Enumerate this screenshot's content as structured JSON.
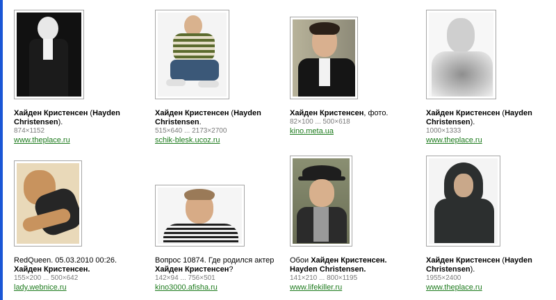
{
  "results": [
    {
      "title_pre": "",
      "title_bold": "Хайден Кристенсен",
      "title_post": " (",
      "title_bold2": "Hayden Christensen",
      "title_end": ").",
      "size": "874×1152",
      "url": "www.theplace.ru"
    },
    {
      "title_pre": "",
      "title_bold": "Хайден Кристенсен",
      "title_post": " (",
      "title_bold2": "Hayden Christensen",
      "title_end": ".",
      "size": "515×640 ... 2173×2700",
      "url": "schik-blesk.ucoz.ru"
    },
    {
      "title_pre": "",
      "title_bold": "Хайден Кристенсен",
      "title_post": ", фото.",
      "title_bold2": "",
      "title_end": "",
      "size": "82×100 ... 500×618",
      "url": "kino.meta.ua"
    },
    {
      "title_pre": "",
      "title_bold": "Хайден Кристенсен",
      "title_post": " (",
      "title_bold2": "Hayden Christensen",
      "title_end": ").",
      "size": "1000×1333",
      "url": "www.theplace.ru"
    },
    {
      "title_pre": "RedQueen. 05.03.2010 00:26. ",
      "title_bold": "Хайден Кристенсен.",
      "title_post": "",
      "title_bold2": "",
      "title_end": "",
      "size": "155×200 ... 500×642",
      "url": "lady.webnice.ru"
    },
    {
      "title_pre": "Вопрос 10874. Где родился актер ",
      "title_bold": "Хайден Кристенсен",
      "title_post": "?",
      "title_bold2": "",
      "title_end": "",
      "size": "142×94 ... 756×501",
      "url": "kino3000.afisha.ru"
    },
    {
      "title_pre": "Обои ",
      "title_bold": "Хайден Кристенсен. Hayden Christensen.",
      "title_post": "",
      "title_bold2": "",
      "title_end": "",
      "size": "141×210 ... 800×1195",
      "url": "www.lifekiller.ru"
    },
    {
      "title_pre": "",
      "title_bold": "Хайден Кристенсен",
      "title_post": " (",
      "title_bold2": "Hayden Christensen",
      "title_end": ").",
      "size": "1955×2400",
      "url": "www.theplace.ru"
    }
  ]
}
